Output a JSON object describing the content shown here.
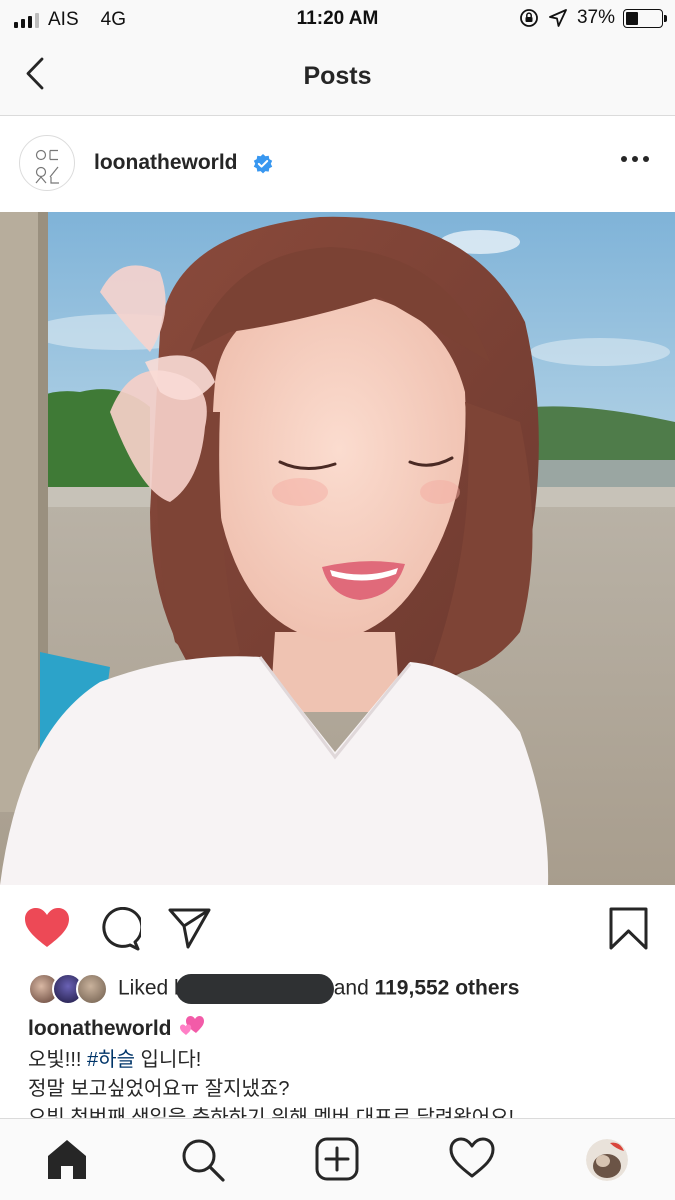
{
  "status_bar": {
    "carrier": "AIS",
    "network": "4G",
    "time": "11:20 AM",
    "battery": "37%",
    "battery_level": 0.37,
    "signal_bars_active": 3,
    "signal_bars_total": 4
  },
  "nav": {
    "title": "Posts",
    "back_icon": "chevron-left-icon"
  },
  "post": {
    "username": "loonatheworld",
    "verified": true,
    "accent_color": "#3897f0",
    "liked": true,
    "like_color": "#ed4956",
    "likes": {
      "prefix": "Liked b",
      "suffix": "and",
      "count": "119,552 others"
    },
    "caption": {
      "username": "loonatheworld",
      "line1_start": "오빛!!!",
      "hashtag": "#하슬",
      "line1_end": "입니다!",
      "line2": "정말 보고싶었어요ㅠ 잘지냈죠?",
      "line3": "오빛 첫번째 생일을 축하하기 위해 멤버 대표로 달려왔어요!"
    }
  },
  "tab_bar": {
    "items": [
      "home-icon",
      "search-icon",
      "new-post-icon",
      "activity-heart-icon",
      "profile-avatar"
    ]
  }
}
